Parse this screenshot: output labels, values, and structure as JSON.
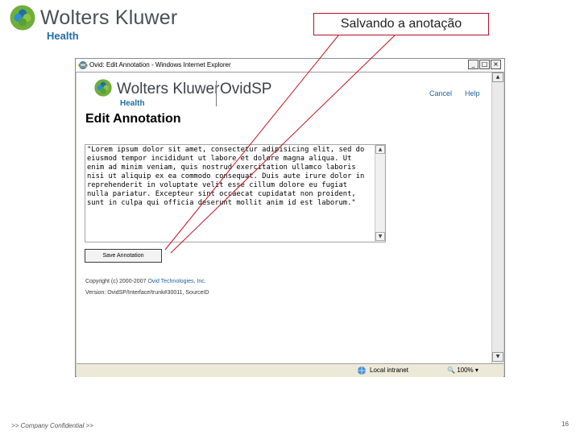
{
  "slide": {
    "brand_name": "Wolters Kluwer",
    "brand_division": "Health",
    "callout_text": "Salvando a anotação",
    "footer_left": ">> Company Confidential >>",
    "page_number": "16"
  },
  "browser": {
    "title": "Ovid: Edit Annotation - Windows Internet Explorer",
    "window_buttons": [
      "_",
      "□",
      "×"
    ],
    "status_zone": "Local intranet",
    "zoom": "100%"
  },
  "page": {
    "brand_name": "Wolters Kluwer",
    "brand_division": "Health",
    "product": "OvidSP",
    "nav": {
      "cancel": "Cancel",
      "help": "Help"
    },
    "heading": "Edit Annotation",
    "annotation_text": "\"Lorem ipsum dolor sit amet, consectetur adipisicing elit, sed do eiusmod tempor incididunt ut labore et dolore magna aliqua. Ut enim ad minim veniam, quis nostrud exercitation ullamco laboris nisi ut aliquip ex ea commodo consequat. Duis aute irure dolor in reprehenderit in voluptate velit esse cillum dolore eu fugiat nulla pariatur. Excepteur sint occaecat cupidatat non proident, sunt in culpa qui officia deserunt mollit anim id est laborum.\"",
    "save_button": "Save Annotation",
    "copyright_prefix": "Copyright (c) 2000-2007 ",
    "copyright_link": "Ovid Technologies, Inc.",
    "version": "Version: OvidSP/Interface/trunk#30011, SourceID"
  },
  "colors": {
    "brand_green": "#6fae3c",
    "brand_blue": "#1f6ea3",
    "callout_border": "#b0112a",
    "callout_lines": "#c0141e",
    "link_blue": "#1f5f9e"
  }
}
